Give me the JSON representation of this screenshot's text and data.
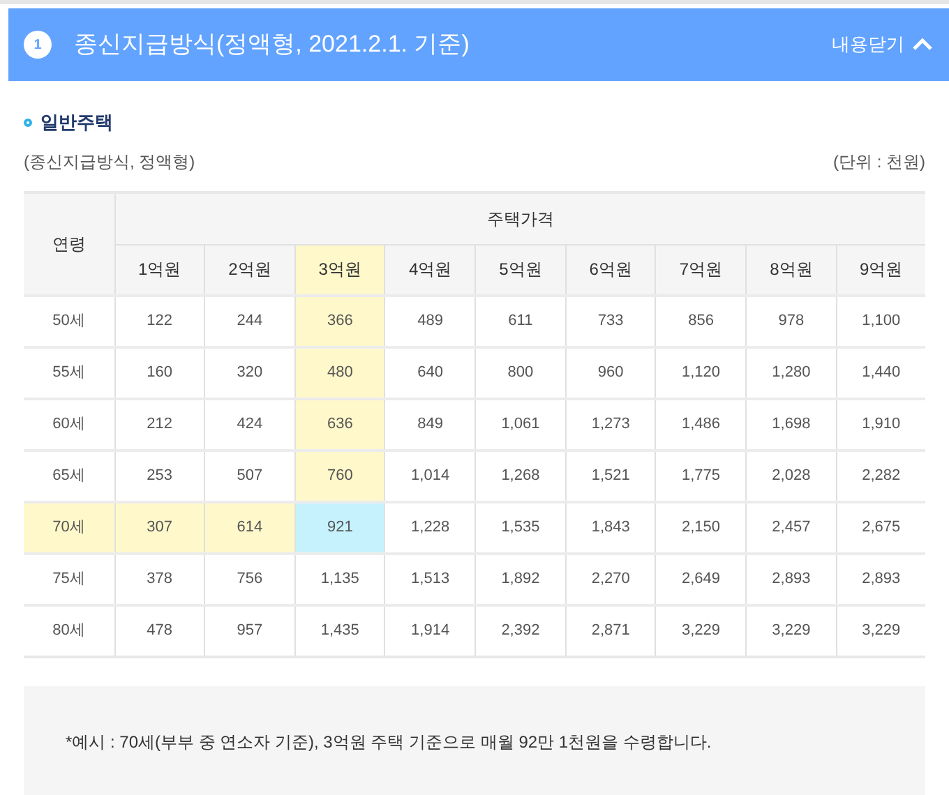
{
  "header": {
    "number": "1",
    "title": "종신지급방식(정액형, 2021.2.1. 기준)",
    "toggle": "내용닫기",
    "expanded": true
  },
  "section": {
    "title": "일반주택",
    "subtitle": "(종신지급방식, 정액형)",
    "unit": "(단위 : 천원)"
  },
  "table": {
    "row_header": "연령",
    "group_header": "주택가격",
    "columns": [
      {
        "label": "1억원",
        "selected": false
      },
      {
        "label": "2억원",
        "selected": false
      },
      {
        "label": "3억원",
        "selected": true
      },
      {
        "label": "4억원",
        "selected": false
      },
      {
        "label": "5억원",
        "selected": false
      },
      {
        "label": "6억원",
        "selected": false
      },
      {
        "label": "7억원",
        "selected": false
      },
      {
        "label": "8억원",
        "selected": false
      },
      {
        "label": "9억원",
        "selected": false
      }
    ],
    "rows": [
      {
        "age": "50세",
        "selected": false,
        "values": [
          "122",
          "244",
          "366",
          "489",
          "611",
          "733",
          "856",
          "978",
          "1,100"
        ]
      },
      {
        "age": "55세",
        "selected": false,
        "values": [
          "160",
          "320",
          "480",
          "640",
          "800",
          "960",
          "1,120",
          "1,280",
          "1,440"
        ]
      },
      {
        "age": "60세",
        "selected": false,
        "values": [
          "212",
          "424",
          "636",
          "849",
          "1,061",
          "1,273",
          "1,486",
          "1,698",
          "1,910"
        ]
      },
      {
        "age": "65세",
        "selected": false,
        "values": [
          "253",
          "507",
          "760",
          "1,014",
          "1,268",
          "1,521",
          "1,775",
          "2,028",
          "2,282"
        ]
      },
      {
        "age": "70세",
        "selected": true,
        "values": [
          "307",
          "614",
          "921",
          "1,228",
          "1,535",
          "1,843",
          "2,150",
          "2,457",
          "2,675"
        ]
      },
      {
        "age": "75세",
        "selected": false,
        "values": [
          "378",
          "756",
          "1,135",
          "1,513",
          "1,892",
          "2,270",
          "2,649",
          "2,893",
          "2,893"
        ]
      },
      {
        "age": "80세",
        "selected": false,
        "values": [
          "478",
          "957",
          "1,435",
          "1,914",
          "2,392",
          "2,871",
          "3,229",
          "3,229",
          "3,229"
        ]
      }
    ]
  },
  "note": "*예시 : 70세(부부 중 연소자 기준), 3억원 주택 기준으로 매월 92만 1천원을 수령합니다."
}
